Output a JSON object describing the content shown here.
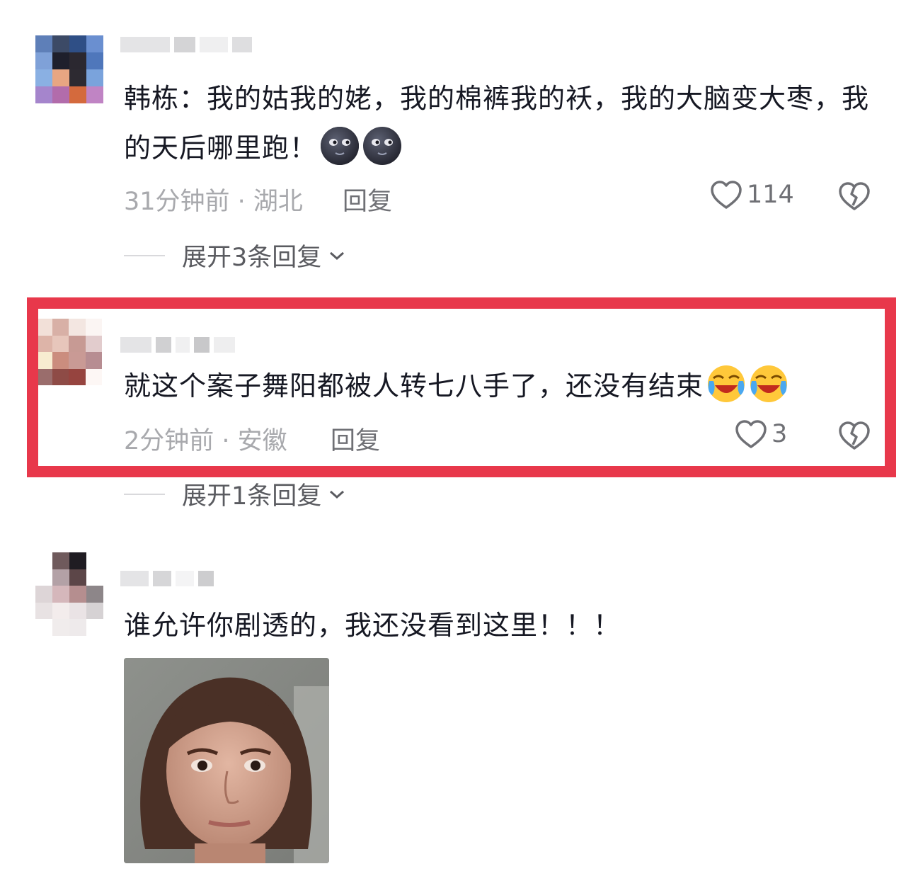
{
  "comments": [
    {
      "text": "韩栋：我的姑我的姥，我的棉裤我的袄，我的大脑变大枣，我的天后哪里跑！",
      "emoji": [
        "moon-face",
        "moon-face"
      ],
      "meta": "31分钟前 · 湖北",
      "reply_label": "回复",
      "likes": "114",
      "expand_label": "展开3条回复",
      "highlighted": false
    },
    {
      "text": "就这个案子舞阳都被人转七八手了，还没有结束",
      "emoji": [
        "laughing-crying",
        "laughing-crying"
      ],
      "meta": "2分钟前 · 安徽",
      "reply_label": "回复",
      "likes": "3",
      "expand_label": "展开1条回复",
      "highlighted": true
    },
    {
      "text": "谁允许你剧透的，我还没看到这里！！！",
      "has_image": true
    }
  ],
  "colors": {
    "highlight_border": "#e8384b",
    "meta_text": "#a8a9ad",
    "body_text": "#161823"
  },
  "icons": [
    "heart-outline-icon",
    "broken-heart-icon",
    "chevron-down-icon"
  ]
}
